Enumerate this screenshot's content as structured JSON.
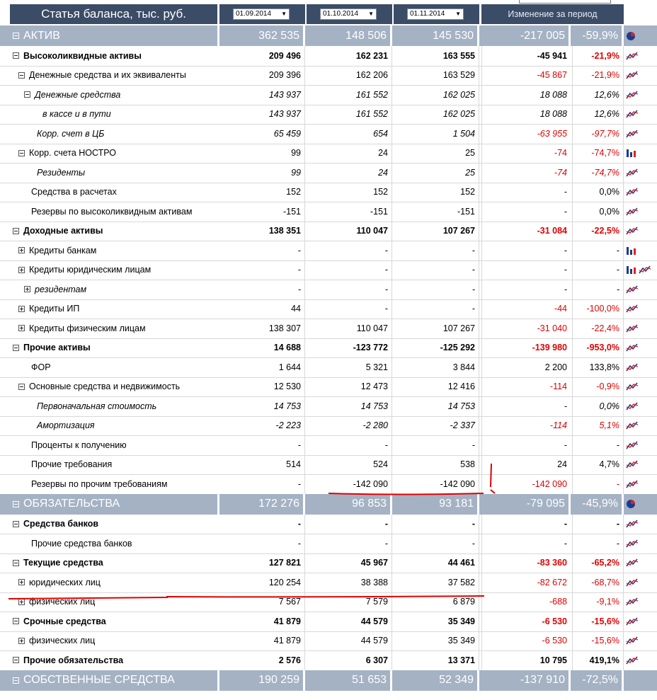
{
  "header": {
    "title": "Статья баланса, тыс. руб.",
    "dates": [
      "01.09.2014",
      "01.10.2014",
      "01.11.2014"
    ],
    "change_label": "Изменение за период"
  },
  "colors": {
    "header_bg": "#3b4c66",
    "section_bg": "#a4b2c4",
    "negative": "#e00000",
    "annotation": "#e00000"
  },
  "rows": [
    {
      "type": "section",
      "label": "АКТИВ",
      "toggle": "minus",
      "v": [
        "362 535",
        "148 506",
        "145 530",
        "-217 005",
        "-59,9%"
      ],
      "icons": [
        "pie-chart-icon"
      ]
    },
    {
      "type": "row",
      "label": "Высоколиквидные активы",
      "toggle": "minus",
      "indent": 0,
      "bold": true,
      "italic": false,
      "v": [
        "209 496",
        "162 231",
        "163 555",
        "-45 941",
        "-21,9%"
      ],
      "neg": [
        false,
        true
      ],
      "icons": [
        "line-chart-icon"
      ]
    },
    {
      "type": "row",
      "label": "Денежные средства и их эквиваленты",
      "toggle": "minus",
      "indent": 1,
      "bold": false,
      "italic": false,
      "v": [
        "209 396",
        "162 206",
        "163 529",
        "-45 867",
        "-21,9%"
      ],
      "neg": [
        true,
        true
      ],
      "icons": [
        "line-chart-icon"
      ]
    },
    {
      "type": "row",
      "label": "Денежные средства",
      "toggle": "minus",
      "indent": 2,
      "bold": false,
      "italic": true,
      "v": [
        "143 937",
        "161 552",
        "162 025",
        "18 088",
        "12,6%"
      ],
      "neg": [
        false,
        false
      ],
      "icons": [
        "line-chart-icon"
      ]
    },
    {
      "type": "row",
      "label": "в кассе и в пути",
      "toggle": "none",
      "indent": 3,
      "bold": false,
      "italic": true,
      "v": [
        "143 937",
        "161 552",
        "162 025",
        "18 088",
        "12,6%"
      ],
      "neg": [
        false,
        false
      ],
      "icons": [
        "line-chart-icon"
      ]
    },
    {
      "type": "row",
      "label": "Корр. счет в ЦБ",
      "toggle": "none",
      "indent": 2,
      "bold": false,
      "italic": true,
      "v": [
        "65 459",
        "654",
        "1 504",
        "-63 955",
        "-97,7%"
      ],
      "neg": [
        true,
        true
      ],
      "icons": [
        "line-chart-icon"
      ]
    },
    {
      "type": "row",
      "label": "Корр. счета НОСТРО",
      "toggle": "minus",
      "indent": 1,
      "bold": false,
      "italic": false,
      "v": [
        "99",
        "24",
        "25",
        "-74",
        "-74,7%"
      ],
      "neg": [
        true,
        true
      ],
      "icons": [
        "bar-chart-icon"
      ]
    },
    {
      "type": "row",
      "label": "Резиденты",
      "toggle": "none",
      "indent": 2,
      "bold": false,
      "italic": true,
      "v": [
        "99",
        "24",
        "25",
        "-74",
        "-74,7%"
      ],
      "neg": [
        true,
        true
      ],
      "icons": [
        "line-chart-icon"
      ]
    },
    {
      "type": "row",
      "label": "Средства в расчетах",
      "toggle": "none",
      "indent": 1,
      "bold": false,
      "italic": false,
      "v": [
        "152",
        "152",
        "152",
        "-",
        "0,0%"
      ],
      "neg": [
        false,
        false
      ],
      "icons": [
        "line-chart-icon"
      ]
    },
    {
      "type": "row",
      "label": "Резервы по высоколиквидным активам",
      "toggle": "none",
      "indent": 1,
      "bold": false,
      "italic": false,
      "v": [
        "-151",
        "-151",
        "-151",
        "-",
        "0,0%"
      ],
      "neg": [
        false,
        false
      ],
      "icons": [
        "line-chart-icon"
      ]
    },
    {
      "type": "row",
      "label": "Доходные активы",
      "toggle": "minus",
      "indent": 0,
      "bold": true,
      "italic": false,
      "v": [
        "138 351",
        "110 047",
        "107 267",
        "-31 084",
        "-22,5%"
      ],
      "neg": [
        true,
        true
      ],
      "icons": [
        "line-chart-icon"
      ]
    },
    {
      "type": "row",
      "label": "Кредиты банкам",
      "toggle": "plus",
      "indent": 1,
      "bold": false,
      "italic": false,
      "v": [
        "-",
        "-",
        "-",
        "-",
        "-"
      ],
      "neg": [
        false,
        false
      ],
      "icons": [
        "bar-chart-icon"
      ]
    },
    {
      "type": "row",
      "label": "Кредиты юридическим лицам",
      "toggle": "plus",
      "indent": 1,
      "bold": false,
      "italic": false,
      "v": [
        "-",
        "-",
        "-",
        "-",
        "-"
      ],
      "neg": [
        false,
        false
      ],
      "icons": [
        "bar-chart-icon",
        "line-chart-icon"
      ]
    },
    {
      "type": "row",
      "label": "резидентам",
      "toggle": "plus",
      "indent": 2,
      "bold": false,
      "italic": true,
      "v": [
        "-",
        "-",
        "-",
        "-",
        "-"
      ],
      "neg": [
        false,
        false
      ],
      "icons": [
        "line-chart-icon"
      ]
    },
    {
      "type": "row",
      "label": "Кредиты ИП",
      "toggle": "plus",
      "indent": 1,
      "bold": false,
      "italic": false,
      "v": [
        "44",
        "-",
        "-",
        "-44",
        "-100,0%"
      ],
      "neg": [
        true,
        true
      ],
      "icons": [
        "line-chart-icon"
      ]
    },
    {
      "type": "row",
      "label": "Кредиты физическим лицам",
      "toggle": "plus",
      "indent": 1,
      "bold": false,
      "italic": false,
      "v": [
        "138 307",
        "110 047",
        "107 267",
        "-31 040",
        "-22,4%"
      ],
      "neg": [
        true,
        true
      ],
      "icons": [
        "line-chart-icon"
      ]
    },
    {
      "type": "row",
      "label": "Прочие активы",
      "toggle": "minus",
      "indent": 0,
      "bold": true,
      "italic": false,
      "v": [
        "14 688",
        "-123 772",
        "-125 292",
        "-139 980",
        "-953,0%"
      ],
      "neg": [
        true,
        true
      ],
      "icons": [
        "line-chart-icon"
      ]
    },
    {
      "type": "row",
      "label": "ФОР",
      "toggle": "none",
      "indent": 1,
      "bold": false,
      "italic": false,
      "v": [
        "1 644",
        "5 321",
        "3 844",
        "2 200",
        "133,8%"
      ],
      "neg": [
        false,
        false
      ],
      "icons": [
        "line-chart-icon"
      ]
    },
    {
      "type": "row",
      "label": "Основные средства и недвижимость",
      "toggle": "minus",
      "indent": 1,
      "bold": false,
      "italic": false,
      "v": [
        "12 530",
        "12 473",
        "12 416",
        "-114",
        "-0,9%"
      ],
      "neg": [
        true,
        true
      ],
      "icons": [
        "line-chart-icon"
      ]
    },
    {
      "type": "row",
      "label": "Первоначальная стоимость",
      "toggle": "none",
      "indent": 2,
      "bold": false,
      "italic": true,
      "v": [
        "14 753",
        "14 753",
        "14 753",
        "-",
        "0,0%"
      ],
      "neg": [
        false,
        false
      ],
      "icons": [
        "line-chart-icon"
      ]
    },
    {
      "type": "row",
      "label": "Амортизация",
      "toggle": "none",
      "indent": 2,
      "bold": false,
      "italic": true,
      "v": [
        "-2 223",
        "-2 280",
        "-2 337",
        "-114",
        "5,1%"
      ],
      "neg": [
        true,
        true
      ],
      "icons": [
        "line-chart-icon"
      ]
    },
    {
      "type": "row",
      "label": "Проценты к получению",
      "toggle": "none",
      "indent": 1,
      "bold": false,
      "italic": false,
      "v": [
        "-",
        "-",
        "-",
        "-",
        "-"
      ],
      "neg": [
        false,
        false
      ],
      "icons": [
        "line-chart-icon"
      ]
    },
    {
      "type": "row",
      "label": "Прочие требования",
      "toggle": "none",
      "indent": 1,
      "bold": false,
      "italic": false,
      "v": [
        "514",
        "524",
        "538",
        "24",
        "4,7%"
      ],
      "neg": [
        false,
        false
      ],
      "icons": [
        "line-chart-icon"
      ]
    },
    {
      "type": "row",
      "label": "Резервы по прочим требованиям",
      "toggle": "none",
      "indent": 1,
      "bold": false,
      "italic": false,
      "v": [
        "-",
        "-142 090",
        "-142 090",
        "-142 090",
        "-"
      ],
      "neg": [
        true,
        true
      ],
      "icons": [
        "line-chart-icon"
      ]
    },
    {
      "type": "section",
      "label": "ОБЯЗАТЕЛЬСТВА",
      "toggle": "minus",
      "v": [
        "172 276",
        "96 853",
        "93 181",
        "-79 095",
        "-45,9%"
      ],
      "icons": [
        "pie-chart-icon"
      ]
    },
    {
      "type": "row",
      "label": "Средства банков",
      "toggle": "minus",
      "indent": 0,
      "bold": true,
      "italic": false,
      "v": [
        "-",
        "-",
        "-",
        "-",
        "-"
      ],
      "neg": [
        false,
        false
      ],
      "icons": [
        "line-chart-icon"
      ]
    },
    {
      "type": "row",
      "label": "Прочие средства банков",
      "toggle": "none",
      "indent": 1,
      "bold": false,
      "italic": false,
      "v": [
        "-",
        "-",
        "-",
        "-",
        "-"
      ],
      "neg": [
        false,
        false
      ],
      "icons": [
        "line-chart-icon"
      ]
    },
    {
      "type": "row",
      "label": "Текущие средства",
      "toggle": "minus",
      "indent": 0,
      "bold": true,
      "italic": false,
      "v": [
        "127 821",
        "45 967",
        "44 461",
        "-83 360",
        "-65,2%"
      ],
      "neg": [
        true,
        true
      ],
      "icons": [
        "line-chart-icon"
      ]
    },
    {
      "type": "row",
      "label": "юридических лиц",
      "toggle": "plus",
      "indent": 1,
      "bold": false,
      "italic": false,
      "v": [
        "120 254",
        "38 388",
        "37 582",
        "-82 672",
        "-68,7%"
      ],
      "neg": [
        true,
        true
      ],
      "icons": [
        "line-chart-icon"
      ]
    },
    {
      "type": "row",
      "label": "физических лиц",
      "toggle": "plus",
      "indent": 1,
      "bold": false,
      "italic": false,
      "v": [
        "7 567",
        "7 579",
        "6 879",
        "-688",
        "-9,1%"
      ],
      "neg": [
        true,
        true
      ],
      "icons": [
        "line-chart-icon"
      ]
    },
    {
      "type": "row",
      "label": "Срочные средства",
      "toggle": "minus",
      "indent": 0,
      "bold": true,
      "italic": false,
      "v": [
        "41 879",
        "44 579",
        "35 349",
        "-6 530",
        "-15,6%"
      ],
      "neg": [
        true,
        true
      ],
      "icons": [
        "line-chart-icon"
      ]
    },
    {
      "type": "row",
      "label": "физических лиц",
      "toggle": "plus",
      "indent": 1,
      "bold": false,
      "italic": false,
      "v": [
        "41 879",
        "44 579",
        "35 349",
        "-6 530",
        "-15,6%"
      ],
      "neg": [
        true,
        true
      ],
      "icons": [
        "line-chart-icon"
      ]
    },
    {
      "type": "row",
      "label": "Прочие обязательства",
      "toggle": "minus",
      "indent": 0,
      "bold": true,
      "italic": false,
      "v": [
        "2 576",
        "6 307",
        "13 371",
        "10 795",
        "419,1%"
      ],
      "neg": [
        false,
        false
      ],
      "icons": [
        "line-chart-icon"
      ]
    },
    {
      "type": "section",
      "label": "СОБСТВЕННЫЕ СРЕДСТВА",
      "toggle": "minus",
      "v": [
        "190 259",
        "51 653",
        "52 349",
        "-137 910",
        "-72,5%"
      ],
      "icons": []
    }
  ]
}
